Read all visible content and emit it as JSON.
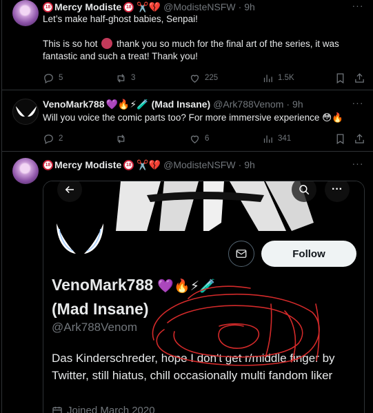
{
  "posts": [
    {
      "name": "Mercy Modiste",
      "badge": "18",
      "name_emojis": "✂️💔",
      "handle": "@ModisteNSFW",
      "time": "9h",
      "lines": [
        "Let’s make half-ghost babies, Senpai!",
        "This is so hot",
        "thank you so much for the final art of the series, it was fantastic and such a treat! Thank you!"
      ],
      "stats": {
        "replies": "5",
        "reposts": "3",
        "likes": "225",
        "views": "1.5K"
      }
    },
    {
      "name": "VenoMark788",
      "name_suffix": "(Mad Insane)",
      "name_emojis": "💜🔥⚡🧪",
      "handle": "@Ark788Venom",
      "time": "9h",
      "text": "Will you voice the comic parts too? For more immersive experience",
      "text_emojis": "😳🔥",
      "stats": {
        "replies": "2",
        "reposts": "",
        "likes": "6",
        "views": "341"
      }
    },
    {
      "name": "Mercy Modiste",
      "badge": "18",
      "name_emojis": "✂️💔",
      "handle": "@ModisteNSFW",
      "time": "9h"
    }
  ],
  "embed": {
    "name_line1": "VenoMark788",
    "name_emojis": "💜🔥⚡🧪",
    "name_line2": "(Mad Insane)",
    "handle": "@Ark788Venom",
    "bio": "Das Kinderschreder, hope I don't get r/middle finger by Twitter, still hiatus, chill occasionally multi fandom liker",
    "joined": "Joined March 2020",
    "follow_label": "Follow"
  },
  "colors": {
    "background": "#000000",
    "text": "#e7e9ea",
    "muted": "#71767b",
    "border": "#2f3336",
    "scribble": "#d42a2a"
  },
  "icons": [
    "more-icon",
    "reply-icon",
    "repost-icon",
    "like-icon",
    "views-icon",
    "bookmark-icon",
    "share-icon",
    "back-arrow-icon",
    "search-icon",
    "mail-icon",
    "calendar-icon"
  ]
}
